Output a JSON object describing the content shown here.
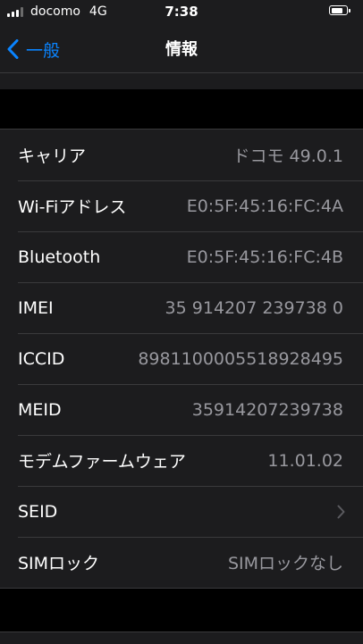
{
  "status_bar": {
    "carrier": "docomo",
    "network": "4G",
    "time": "7:38",
    "signal_bars": 3,
    "signal_bars_total": 4,
    "battery_level": 0.8
  },
  "nav": {
    "back_label": "一般",
    "title": "情報"
  },
  "rows": [
    {
      "label": "キャリア",
      "value": "ドコモ 49.0.1"
    },
    {
      "label": "Wi-Fiアドレス",
      "value": "E0:5F:45:16:FC:4A"
    },
    {
      "label": "Bluetooth",
      "value": "E0:5F:45:16:FC:4B"
    },
    {
      "label": "IMEI",
      "value": "35 914207 239738 0"
    },
    {
      "label": "ICCID",
      "value": "8981100005518928495"
    },
    {
      "label": "MEID",
      "value": "35914207239738"
    },
    {
      "label": "モデムファームウェア",
      "value": "11.01.02"
    },
    {
      "label": "SEID",
      "value": ""
    },
    {
      "label": "SIMロック",
      "value": "SIMロックなし"
    }
  ],
  "colors": {
    "accent": "#0a84ff",
    "background": "#000000",
    "cell": "#1c1c1e",
    "separator": "#3a3a3c",
    "secondary_text": "#98989e"
  },
  "icons": {
    "back": "chevron-left-icon",
    "disclosure": "chevron-right-icon",
    "signal": "signal-icon",
    "battery": "battery-icon"
  }
}
